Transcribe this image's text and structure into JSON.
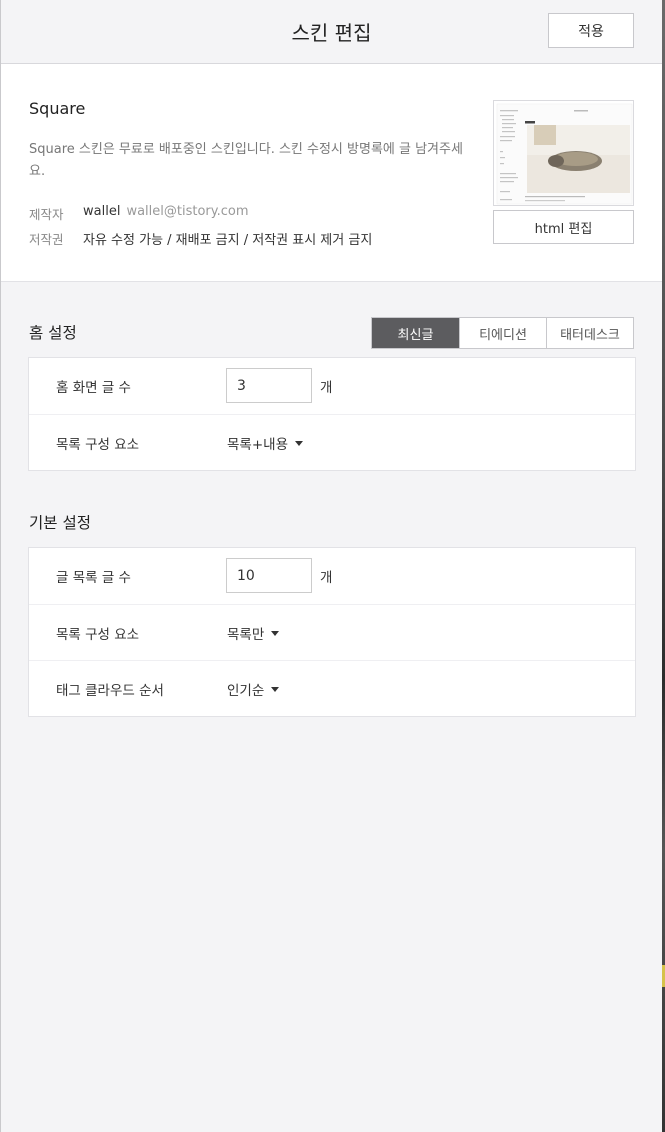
{
  "header": {
    "title": "스킨 편집",
    "apply_label": "적용"
  },
  "skin": {
    "name": "Square",
    "description": "Square 스킨은 무료로 배포중인 스킨입니다. 스킨 수정시 방명록에 글 남겨주세요.",
    "author_key": "제작자",
    "author_name": "wallel",
    "author_email": "wallel@tistory.com",
    "license_key": "저작권",
    "license_value": "자유 수정 가능 / 재배포 금지 / 저작권 표시 제거 금지",
    "html_edit_label": "html 편집"
  },
  "home_settings": {
    "title": "홈 설정",
    "tabs": [
      {
        "label": "최신글",
        "active": true
      },
      {
        "label": "티에디션",
        "active": false
      },
      {
        "label": "태터데스크",
        "active": false
      }
    ],
    "rows": {
      "post_count_label": "홈 화면 글 수",
      "post_count_value": "3",
      "post_count_unit": "개",
      "list_component_label": "목록 구성 요소",
      "list_component_value": "목록+내용"
    }
  },
  "basic_settings": {
    "title": "기본 설정",
    "rows": {
      "list_count_label": "글 목록 글 수",
      "list_count_value": "10",
      "list_count_unit": "개",
      "list_component_label": "목록 구성 요소",
      "list_component_value": "목록만",
      "tag_order_label": "태그 클라우드 순서",
      "tag_order_value": "인기순"
    }
  },
  "colors": {
    "active_tab": "#5c5c5f",
    "panel_bg": "#f4f4f6",
    "card_bg": "#ffffff"
  }
}
